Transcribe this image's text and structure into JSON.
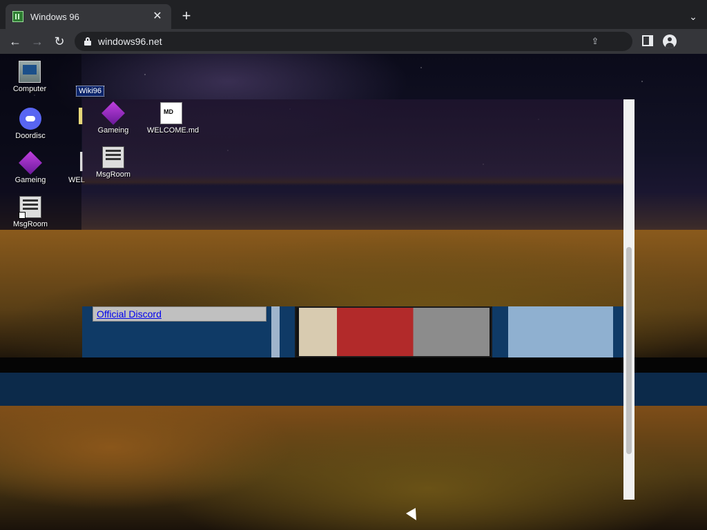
{
  "browser": {
    "tab_title": "Windows 96",
    "close_glyph": "✕",
    "newtab_glyph": "+",
    "tabmenu_glyph": "⌄",
    "url": "windows96.net",
    "back_glyph": "←",
    "forward_glyph": "→",
    "reload_glyph": "↻",
    "share_glyph": "⇪"
  },
  "desktop": {
    "icons": [
      {
        "label": "Computer",
        "icon": "computer-icon"
      },
      {
        "label": "Doordisc",
        "icon": "discord-icon"
      },
      {
        "label": "Gameing",
        "icon": "cube-icon"
      },
      {
        "label": "MsgRoom",
        "icon": "msgroom-icon"
      }
    ],
    "selected_label": "Wiki96",
    "partial_label": "WEL",
    "window_icons": [
      {
        "label": "Gameing",
        "icon": "cube-icon"
      },
      {
        "label": "WELCOME.md",
        "icon": "markdown-file-icon"
      },
      {
        "label": "MsgRoom",
        "icon": "msgroom-icon"
      }
    ]
  },
  "window": {
    "link_text": "Official Discord"
  },
  "colors": {
    "chrome_dark": "#202124",
    "chrome_mid": "#35363a",
    "selection": "#0a246a",
    "page_blue": "#0f3a66"
  }
}
